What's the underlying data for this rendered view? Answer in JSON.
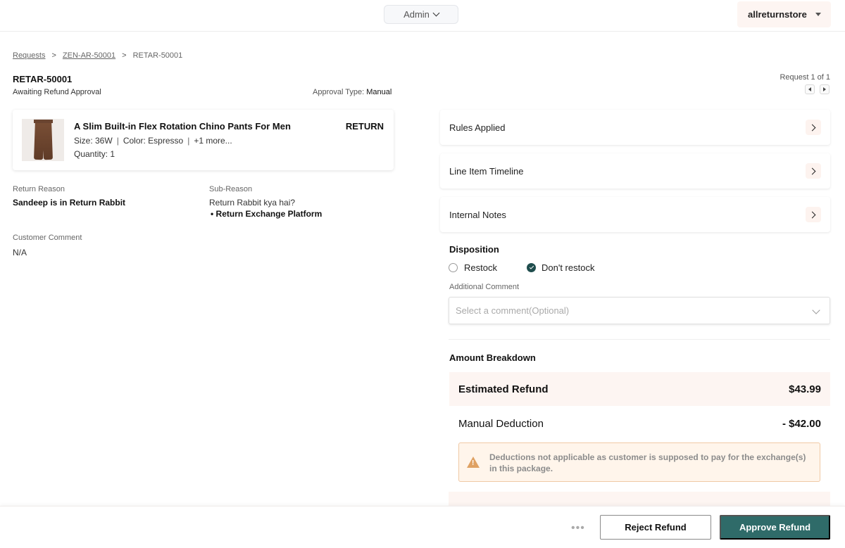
{
  "header": {
    "role_label": "Admin",
    "store_name": "allreturnstore"
  },
  "breadcrumb": {
    "items": [
      "Requests",
      "ZEN-AR-50001",
      "RETAR-50001"
    ],
    "separator": ">"
  },
  "request": {
    "id": "RETAR-50001",
    "status": "Awaiting Refund Approval",
    "approval_type_label": "Approval Type:",
    "approval_type_value": "Manual",
    "pager_text": "Request 1 of 1"
  },
  "product": {
    "name": "A Slim Built-in Flex Rotation Chino Pants For Men",
    "tag": "RETURN",
    "size": "Size: 36W",
    "color": "Color: Espresso",
    "more": "+1 more...",
    "attr_separator": "|",
    "quantity": "Quantity: 1"
  },
  "return_info": {
    "reason_label": "Return Reason",
    "reason_value": "Sandeep is in Return Rabbit",
    "sub_reason_label": "Sub-Reason",
    "sub_reason_question": "Return Rabbit kya hai?",
    "sub_reason_answer": "Return Exchange Platform",
    "comment_label": "Customer Comment",
    "comment_value": "N/A"
  },
  "panels": {
    "rules_applied": "Rules Applied",
    "line_item_timeline": "Line Item Timeline",
    "internal_notes": "Internal Notes"
  },
  "disposition": {
    "title": "Disposition",
    "options": [
      {
        "label": "Restock",
        "selected": false
      },
      {
        "label": "Don't restock",
        "selected": true
      }
    ],
    "additional_comment_label": "Additional Comment",
    "comment_placeholder": "Select a comment(Optional)"
  },
  "amount": {
    "title": "Amount Breakdown",
    "estimated_label": "Estimated Refund",
    "estimated_value": "$43.99",
    "deduction_label": "Manual Deduction",
    "deduction_value": "- $42.00",
    "warning": "Deductions not applicable as customer is supposed to pay for the exchange(s) in this package."
  },
  "footer": {
    "more": "•••",
    "reject_label": "Reject Refund",
    "approve_label": "Approve Refund"
  },
  "colors": {
    "accent": "#2f6b69",
    "highlight_bg": "#fdf5f2",
    "warning_bg": "#fff5eb",
    "warning_icon": "#dfa163"
  }
}
